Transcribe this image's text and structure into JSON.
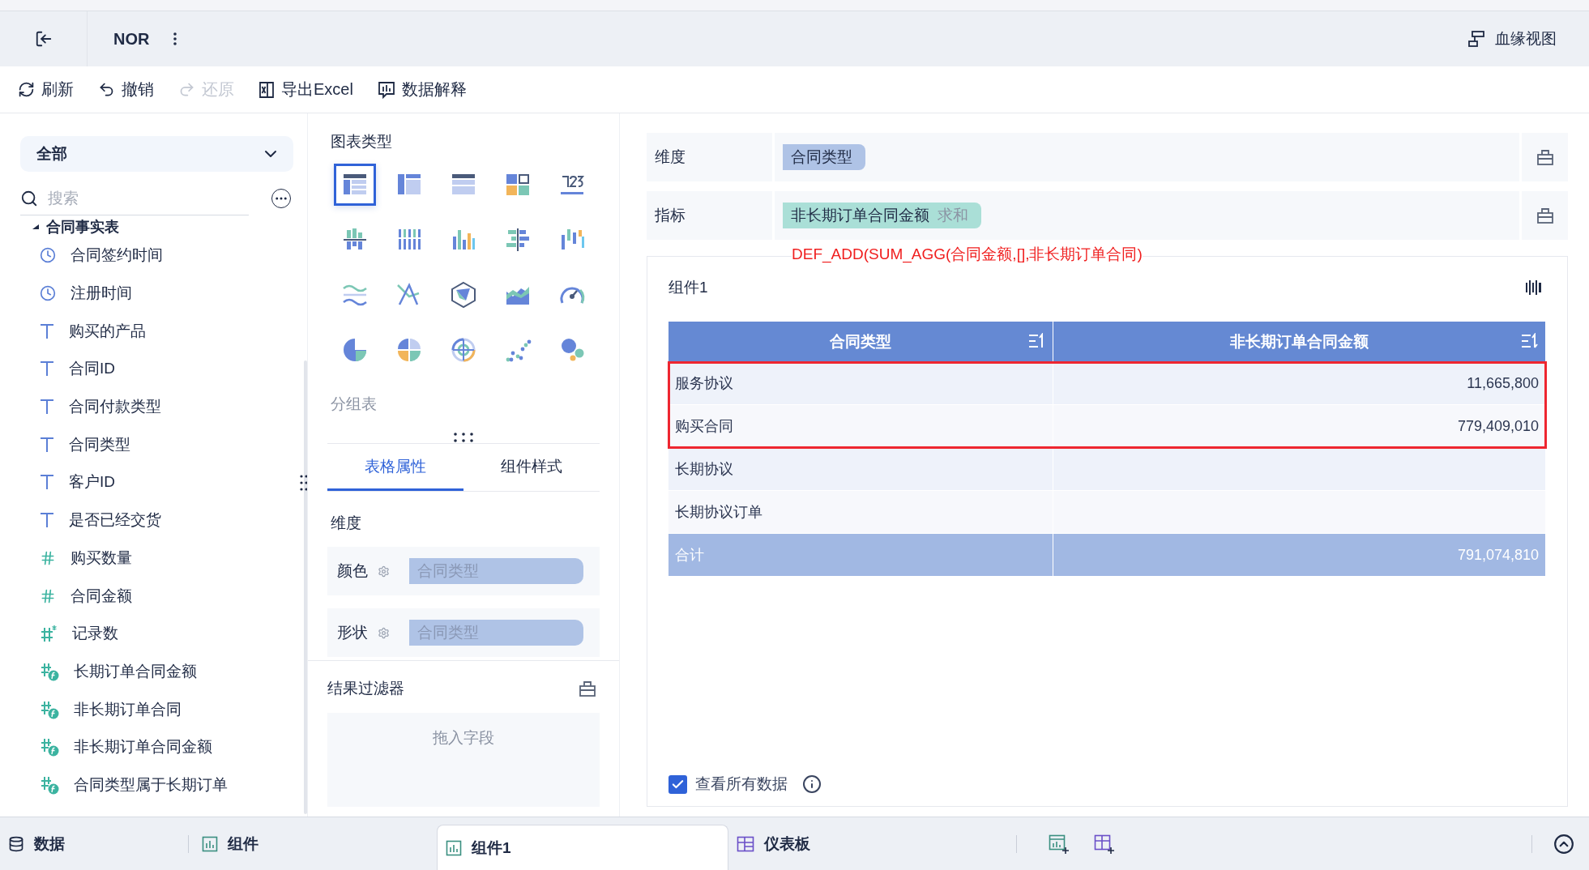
{
  "header": {
    "title": "NOR",
    "lineage_button": "血缘视图"
  },
  "toolbar": [
    {
      "label": "刷新",
      "kind": "refresh",
      "disabled": false
    },
    {
      "label": "撤销",
      "kind": "undo",
      "disabled": false
    },
    {
      "label": "还原",
      "kind": "redo",
      "disabled": true
    },
    {
      "label": "导出Excel",
      "kind": "excel",
      "disabled": false
    },
    {
      "label": "数据解释",
      "kind": "explain",
      "disabled": false
    }
  ],
  "field_panel": {
    "scope": "全部",
    "search_placeholder": "搜索",
    "tree": {
      "label": "合同事实表",
      "expanded": true,
      "children": [
        {
          "label": "合同签约时间",
          "kind": "date"
        },
        {
          "label": "注册时间",
          "kind": "date"
        },
        {
          "label": "购买的产品",
          "kind": "text"
        },
        {
          "label": "合同ID",
          "kind": "text"
        },
        {
          "label": "合同付款类型",
          "kind": "text"
        },
        {
          "label": "合同类型",
          "kind": "text"
        },
        {
          "label": "客户ID",
          "kind": "text"
        },
        {
          "label": "是否已经交货",
          "kind": "text"
        },
        {
          "label": "购买数量",
          "kind": "number"
        },
        {
          "label": "合同金额",
          "kind": "number"
        },
        {
          "label": "记录数",
          "kind": "count"
        },
        {
          "label": "长期订单合同金额",
          "kind": "calc"
        },
        {
          "label": "非长期订单合同",
          "kind": "calc"
        },
        {
          "label": "非长期订单合同金额",
          "kind": "calc"
        },
        {
          "label": "合同类型属于长期订单",
          "kind": "calc"
        }
      ]
    }
  },
  "chart_panel": {
    "title": "图表类型",
    "chart_types": [
      {
        "selected": true
      },
      {
        "selected": false
      },
      {
        "selected": false
      },
      {
        "selected": false
      },
      {
        "selected": false
      },
      {
        "selected": false
      },
      {
        "selected": false
      },
      {
        "selected": false
      },
      {
        "selected": false
      },
      {
        "selected": false
      },
      {
        "selected": false
      },
      {
        "selected": false
      },
      {
        "selected": false
      },
      {
        "selected": false
      },
      {
        "selected": false
      },
      {
        "selected": false
      },
      {
        "selected": false
      },
      {
        "selected": false
      },
      {
        "selected": false
      },
      {
        "selected": false
      }
    ],
    "chart_name": "分组表",
    "tabs": [
      {
        "label": "表格属性",
        "selected": true
      },
      {
        "label": "组件样式",
        "selected": false
      }
    ],
    "section": "维度",
    "properties": [
      {
        "label": "颜色",
        "field": "合同类型"
      },
      {
        "label": "形状",
        "field": "合同类型"
      }
    ],
    "filter": {
      "title": "结果过滤器",
      "drop_hint": "拖入字段"
    }
  },
  "shelves": [
    {
      "label": "维度",
      "field": "合同类型",
      "kind": "dimension"
    },
    {
      "label": "指标",
      "field": "非长期订单合同金额",
      "aggregation": "求和",
      "kind": "measure"
    }
  ],
  "annotation": "DEF_ADD(SUM_AGG(合同金额,[],非长期订单合同)",
  "widget": {
    "title": "组件1",
    "table": {
      "columns": [
        "合同类型",
        "非长期订单合同金额"
      ],
      "rows": [
        {
          "cells": [
            "服务协议",
            "11,665,800"
          ],
          "highlighted": true
        },
        {
          "cells": [
            "购买合同",
            "779,409,010"
          ],
          "highlighted": true
        },
        {
          "cells": [
            "长期协议"
          ],
          "highlighted": false
        },
        {
          "cells": [
            "长期协议订单"
          ],
          "highlighted": false
        }
      ],
      "total": [
        "合计",
        "791,074,810"
      ]
    },
    "show_all": {
      "label": "查看所有数据",
      "checked": true
    }
  },
  "bottom_bar": {
    "tabs": [
      {
        "label": "数据",
        "kind": "data",
        "selected": false
      },
      {
        "label": "组件",
        "kind": "chart",
        "selected": false
      },
      {
        "label": "组件1",
        "kind": "chart",
        "selected": true
      },
      {
        "label": "仪表板",
        "kind": "dashboard",
        "selected": false
      }
    ]
  }
}
